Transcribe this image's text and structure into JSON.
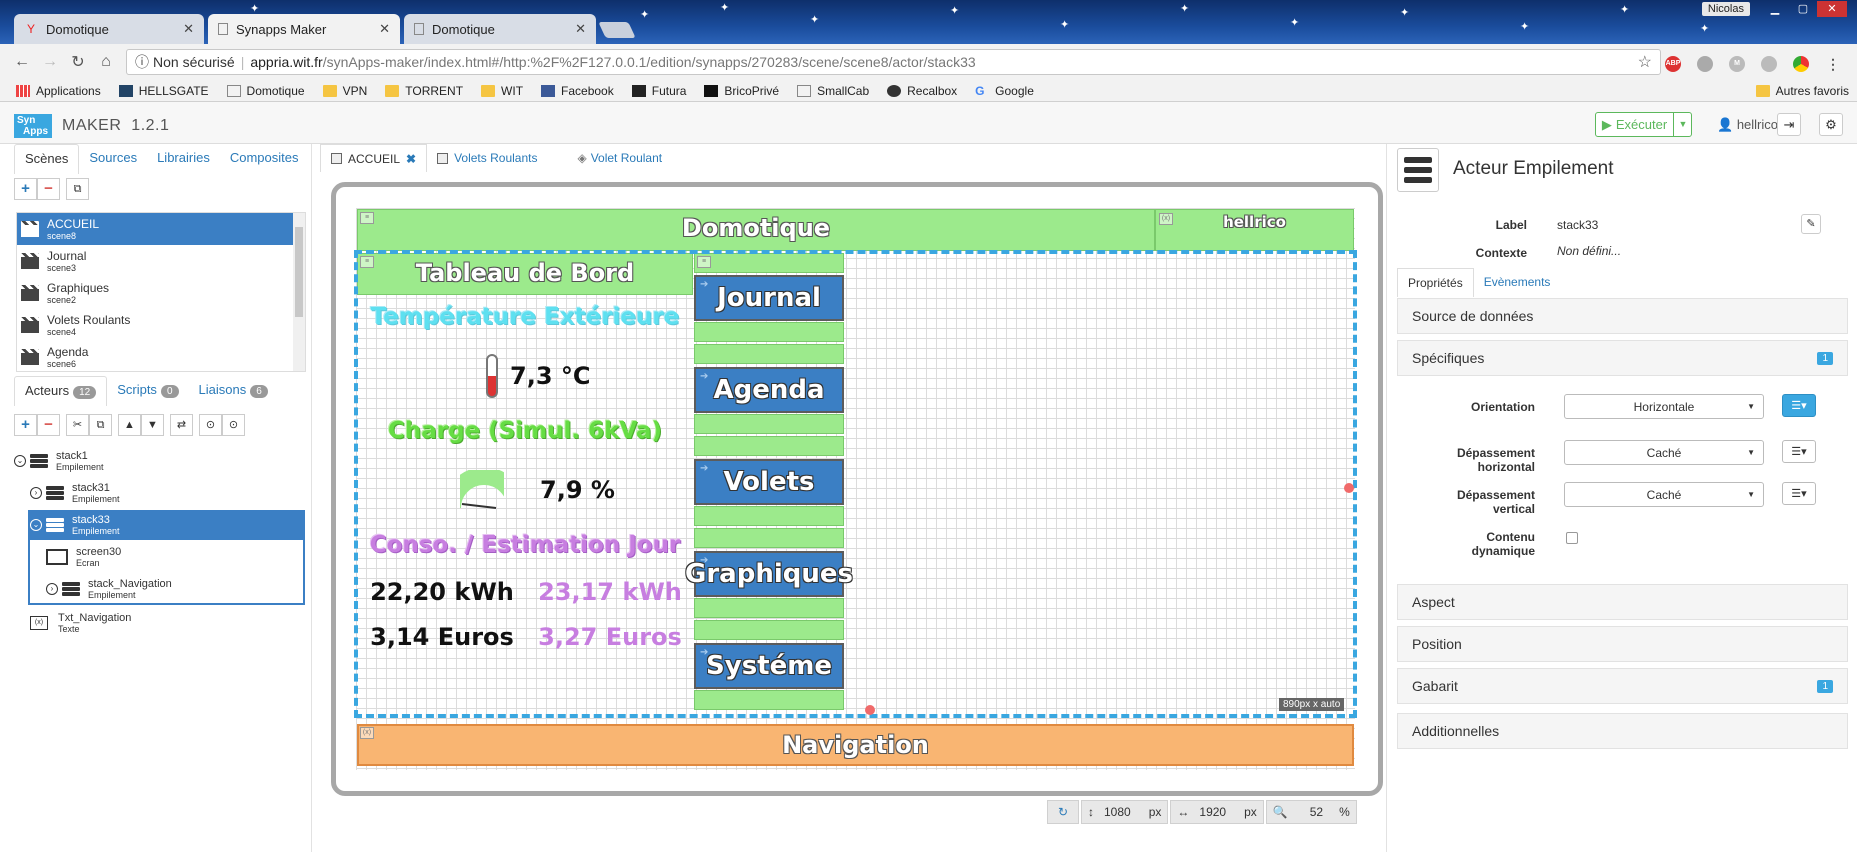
{
  "browser": {
    "tabs": [
      {
        "title": "Domotique",
        "icon": "yandex-icon"
      },
      {
        "title": "Synapps Maker",
        "icon": "page-icon"
      },
      {
        "title": "Domotique",
        "icon": "page-icon"
      }
    ],
    "window_user": "Nicolas",
    "security_label": "Non sécurisé",
    "url_host": "appria.wit.fr",
    "url_path": "/synApps-maker/index.html#/http:%2F%2F127.0.0.1/edition/synapps/270283/scene/scene8/actor/stack33",
    "extensions": [
      "ABP",
      "",
      "M",
      "",
      "",
      ""
    ],
    "bookmarks": [
      "Applications",
      "HELLSGATE",
      "Domotique",
      "VPN",
      "TORRENT",
      "WIT",
      "Facebook",
      "Futura",
      "BricoPrivé",
      "SmallCab",
      "Recalbox",
      "Google"
    ],
    "other_bookmarks": "Autres favoris"
  },
  "app": {
    "logo_line1": "Syn",
    "logo_line2": "Apps",
    "name": "MAKER",
    "version": "1.2.1",
    "run_label": "Exécuter",
    "user": "hellrico"
  },
  "left": {
    "tabs": [
      "Scènes",
      "Sources",
      "Librairies",
      "Composites"
    ],
    "scenes": [
      {
        "name": "ACCUEIL",
        "id": "scene8",
        "selected": true
      },
      {
        "name": "Journal",
        "id": "scene3"
      },
      {
        "name": "Graphiques",
        "id": "scene2"
      },
      {
        "name": "Volets Roulants",
        "id": "scene4"
      },
      {
        "name": "Agenda",
        "id": "scene6"
      }
    ],
    "actor_tabs": [
      {
        "label": "Acteurs",
        "count": "12"
      },
      {
        "label": "Scripts",
        "count": "0"
      },
      {
        "label": "Liaisons",
        "count": "6"
      }
    ],
    "tree": [
      {
        "name": "stack1",
        "type": "Empilement"
      },
      {
        "name": "stack31",
        "type": "Empilement"
      },
      {
        "name": "stack33",
        "type": "Empilement"
      },
      {
        "name": "screen30",
        "type": "Ecran"
      },
      {
        "name": "stack_Navigation",
        "type": "Empilement"
      },
      {
        "name": "Txt_Navigation",
        "type": "Texte"
      }
    ]
  },
  "center": {
    "tabs": [
      "ACCUEIL",
      "Volets Roulants",
      "Volet Roulant"
    ],
    "canvas": {
      "header_title": "Domotique",
      "header_user": "hellrico",
      "dashboard_title": "Tableau de Bord",
      "temp_title": "Température Extérieure",
      "temp_value": "7,3 °C",
      "charge_title": "Charge (Simul. 6kVa)",
      "charge_value": "7,9 %",
      "charge_fraction": 0.079,
      "conso_title": "Conso. / Estimation Jour",
      "kwh_actual": "22,20 kWh",
      "kwh_estimate": "23,17 kWh",
      "euro_actual": "3,14 Euros",
      "euro_estimate": "3,27 Euros",
      "nav_buttons": [
        "Journal",
        "Agenda",
        "Volets",
        "Graphiques",
        "Systéme"
      ],
      "size_tag": "890px x auto",
      "footer_title": "Navigation"
    },
    "height": "1080",
    "width": "1920",
    "unit": "px",
    "zoom": "52",
    "zoom_unit": "%"
  },
  "right": {
    "title": "Acteur Empilement",
    "label_caption": "Label",
    "label_value": "stack33",
    "context_caption": "Contexte",
    "context_value": "Non défini...",
    "tabs": [
      "Propriétés",
      "Evènements"
    ],
    "sections": [
      {
        "title": "Source de données"
      },
      {
        "title": "Spécifiques",
        "count": "1"
      },
      {
        "title": "Aspect"
      },
      {
        "title": "Position"
      },
      {
        "title": "Gabarit",
        "count": "1"
      },
      {
        "title": "Additionnelles"
      }
    ],
    "orientation_caption": "Orientation",
    "orientation_value": "Horizontale",
    "overflow_h_caption1": "Dépassement",
    "overflow_h_caption2": "horizontal",
    "overflow_h_value": "Caché",
    "overflow_v_caption1": "Dépassement",
    "overflow_v_caption2": "vertical",
    "overflow_v_value": "Caché",
    "dynamic_caption1": "Contenu",
    "dynamic_caption2": "dynamique"
  },
  "colors": {
    "accent": "#3b7fc4",
    "green": "#9cea8c",
    "cyan_text": "#5ee0f0",
    "green_text": "#66dd44",
    "purple_text": "#c77ee0",
    "nav_orange": "#f9b572"
  }
}
